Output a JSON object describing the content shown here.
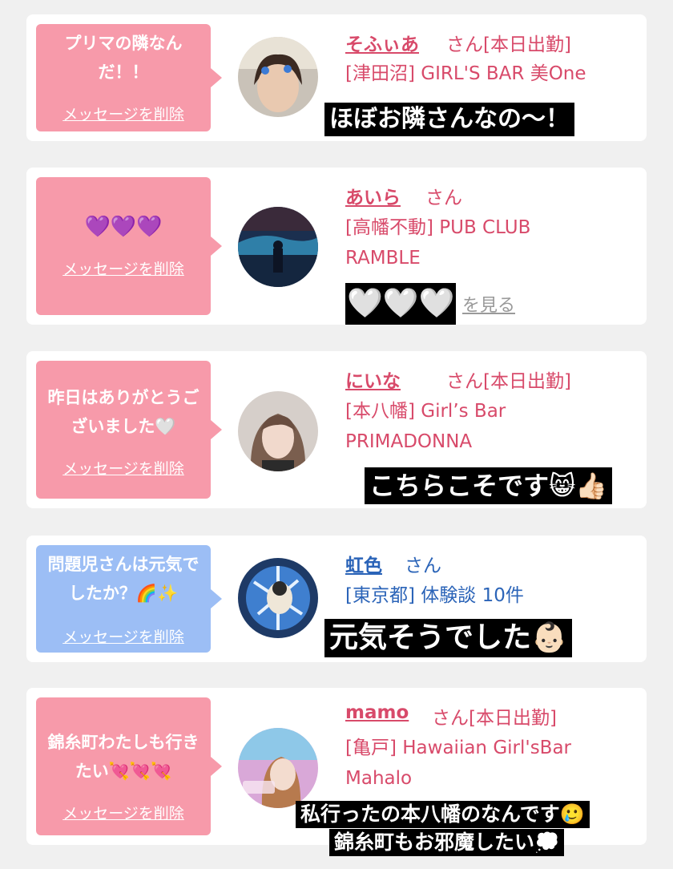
{
  "delete_label": "メッセージを削除",
  "see_more_label": "を見る",
  "messages": [
    {
      "bubble": "プリマの隣なんだ！！",
      "name": "そふぃあ",
      "honorific": "さん[本日出勤]",
      "shop": "[津田沼] GIRL'S BAR 美One",
      "caption": "ほぼお隣さんなの〜！",
      "theme": "pink"
    },
    {
      "bubble": "💜💜💜",
      "name": "あいら",
      "honorific": "さん",
      "shop": "[高幡不動] PUB CLUB RAMBLE",
      "caption": "🤍🤍🤍",
      "theme": "pink"
    },
    {
      "bubble": "昨日はありがとうございました🤍",
      "name": "にいな",
      "honorific": "さん[本日出勤]",
      "shop": "[本八幡] Girl’s Bar PRIMADONNA",
      "caption": "こちらこそです😸👍🏻",
      "theme": "pink"
    },
    {
      "bubble": "問題児さんは元気でしたか？🌈✨",
      "name": "虹色",
      "honorific": "さん",
      "shop": "[東京都] 体験談 10件",
      "caption": "元気そうでした👶🏻",
      "theme": "blue"
    },
    {
      "bubble": "錦糸町わたしも行きたい💘💘💘",
      "name": "mamo",
      "honorific": "さん[本日出勤]",
      "shop": "[亀戸] Hawaiian Girl'sBar Mahalo",
      "caption_line1": "私行ったの本八幡のなんです🥲",
      "caption_line2": "錦糸町もお邪魔したい💭",
      "theme": "pink"
    }
  ],
  "colors": {
    "pink_bubble": "#f79aaa",
    "blue_bubble": "#9cbef5",
    "pink_text": "#d84a6a",
    "blue_text": "#2b64b8"
  }
}
